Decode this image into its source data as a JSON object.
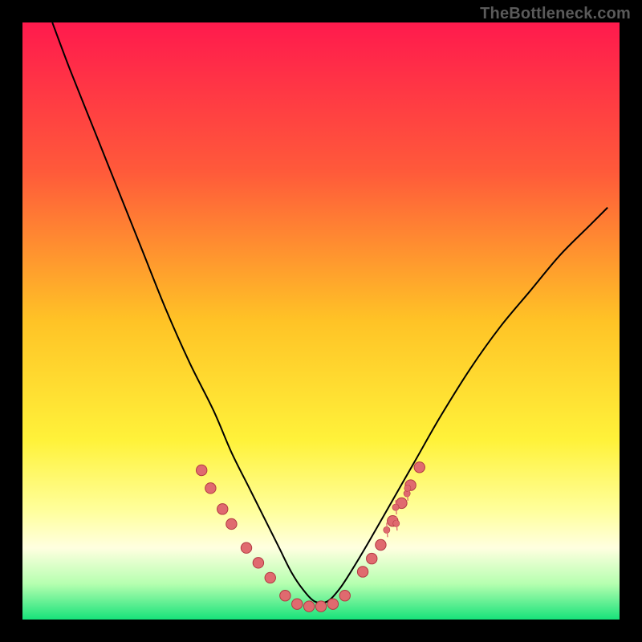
{
  "watermark": "TheBottleneck.com",
  "chart_data": {
    "type": "line",
    "title": "",
    "xlabel": "",
    "ylabel": "",
    "xlim": [
      0,
      100
    ],
    "ylim": [
      0,
      100
    ],
    "background_gradient": {
      "stops": [
        {
          "offset": 0.0,
          "color": "#ff1a4d"
        },
        {
          "offset": 0.25,
          "color": "#ff5a3a"
        },
        {
          "offset": 0.5,
          "color": "#ffc326"
        },
        {
          "offset": 0.7,
          "color": "#fff23a"
        },
        {
          "offset": 0.82,
          "color": "#ffff9e"
        },
        {
          "offset": 0.88,
          "color": "#ffffe0"
        },
        {
          "offset": 0.94,
          "color": "#b6ffb0"
        },
        {
          "offset": 1.0,
          "color": "#17e27a"
        }
      ]
    },
    "series": [
      {
        "name": "bottleneck-curve",
        "color": "#000000",
        "x": [
          5,
          8,
          12,
          16,
          20,
          24,
          28,
          32,
          35,
          38,
          41,
          43,
          45,
          47,
          49,
          51,
          53,
          55,
          58,
          62,
          66,
          70,
          75,
          80,
          85,
          90,
          95,
          98
        ],
        "y": [
          100,
          92,
          82,
          72,
          62,
          52,
          43,
          35,
          28,
          22,
          16,
          12,
          8,
          5,
          3,
          3,
          5,
          8,
          13,
          20,
          27,
          34,
          42,
          49,
          55,
          61,
          66,
          69
        ]
      }
    ],
    "markers": {
      "shape": "circle",
      "radius_pct": 0.9,
      "fill": "#e06a6f",
      "stroke": "#b23a42",
      "points_left": [
        [
          30,
          25
        ],
        [
          31.5,
          22
        ],
        [
          33.5,
          18.5
        ],
        [
          35,
          16
        ],
        [
          37.5,
          12
        ],
        [
          39.5,
          9.5
        ],
        [
          41.5,
          7
        ]
      ],
      "points_bottom": [
        [
          44,
          4
        ],
        [
          46,
          2.6
        ],
        [
          48,
          2.2
        ],
        [
          50,
          2.2
        ],
        [
          52,
          2.6
        ],
        [
          54,
          4
        ]
      ],
      "points_right": [
        [
          57,
          8
        ],
        [
          58.5,
          10.2
        ],
        [
          60,
          12.5
        ],
        [
          62,
          16.5
        ],
        [
          63.5,
          19.5
        ],
        [
          65,
          22.5
        ],
        [
          66.5,
          25.5
        ]
      ]
    },
    "right_cluster_jitter": {
      "fill": "#e06a6f",
      "stroke": "#b23a42",
      "base_points": [
        [
          61,
          14.5
        ],
        [
          62,
          16.5
        ],
        [
          63,
          18.5
        ],
        [
          64,
          20.5
        ],
        [
          64.8,
          22.2
        ]
      ],
      "jitter_dx": [
        0.0,
        0.6,
        -0.5,
        0.4,
        -0.3
      ],
      "jitter_dy": [
        0.5,
        -0.4,
        0.3,
        0.6,
        -0.2
      ]
    }
  }
}
